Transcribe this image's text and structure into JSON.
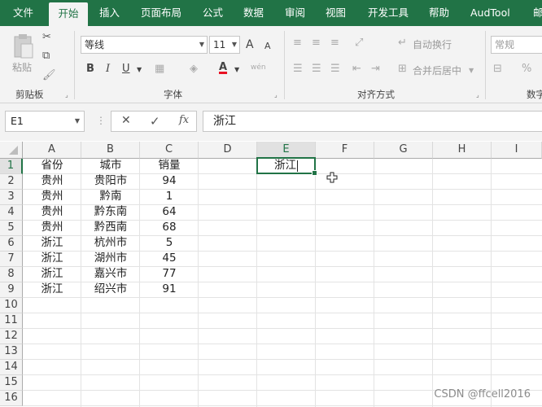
{
  "tabs": [
    "文件",
    "开始",
    "插入",
    "页面布局",
    "公式",
    "数据",
    "审阅",
    "视图",
    "开发工具",
    "帮助",
    "AudTool",
    "邮"
  ],
  "active_tab": "开始",
  "ribbon": {
    "clipboard": {
      "label": "剪贴板",
      "paste": "粘贴"
    },
    "font": {
      "label": "字体",
      "name": "等线",
      "size": "11",
      "grow": "A",
      "shrink": "A",
      "bold": "B",
      "italic": "I",
      "underline": "U",
      "font_color": "A",
      "phonetic": "wén"
    },
    "alignment": {
      "label": "对齐方式",
      "wrap": "自动换行",
      "merge": "合并后居中"
    },
    "number": {
      "label": "数字",
      "format": "常规",
      "percent": "%"
    }
  },
  "formula_bar": {
    "name_box": "E1",
    "cancel": "✕",
    "confirm": "✓",
    "fx": "fx",
    "content": "浙江"
  },
  "grid": {
    "columns": [
      "A",
      "B",
      "C",
      "D",
      "E",
      "F",
      "G",
      "H",
      "I"
    ],
    "rows": [
      "1",
      "2",
      "3",
      "4",
      "5",
      "6",
      "7",
      "8",
      "9",
      "10",
      "11",
      "12",
      "13",
      "14",
      "15",
      "16"
    ],
    "selected_column": "E",
    "selected_row": "1",
    "data": [
      [
        "省份",
        "城市",
        "销量"
      ],
      [
        "贵州",
        "贵阳市",
        "94"
      ],
      [
        "贵州",
        "黔南",
        "1"
      ],
      [
        "贵州",
        "黔东南",
        "64"
      ],
      [
        "贵州",
        "黔西南",
        "68"
      ],
      [
        "浙江",
        "杭州市",
        "5"
      ],
      [
        "浙江",
        "湖州市",
        "45"
      ],
      [
        "浙江",
        "嘉兴市",
        "77"
      ],
      [
        "浙江",
        "绍兴市",
        "91"
      ]
    ],
    "active_cell_text": "浙江"
  },
  "colors": {
    "accent": "#217346",
    "ribbon_bg": "#f3f3f3",
    "font_color_bar": "#e81123"
  },
  "watermark": "CSDN @ffcell2016"
}
